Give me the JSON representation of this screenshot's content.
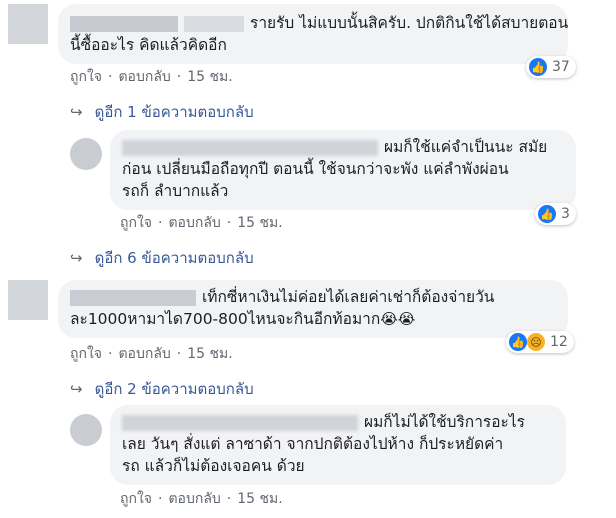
{
  "comments": [
    {
      "text": "รายรับ ไม่แบบนั้นสิครับ. ปกติกินใช้ได้สบายตอนนี้ซื้ออะไร คิดแล้วคิดอีก",
      "line1": "รายรับ ไม่แบบนั้นสิครับ. ปกติกินใช้ได้สบายตอน",
      "line2": "นี้ซื้ออะไร คิดแล้วคิดอีก",
      "like": "ถูกใจ",
      "reply": "ตอบกลับ",
      "time": "15 ชม.",
      "reaction_count": "37",
      "more_replies": "ดูอีก 1 ข้อความตอบกลับ"
    },
    {
      "line1": "ผมก็ใช้แค่จำเป็นนะ สมัย",
      "line2": "ก่อน เปลี่ยนมือถือทุกปี ตอนนี้ ใช้จนกว่าจะพัง แค่ลำพังผ่อน",
      "line3": "รถก็ ลำบากแล้ว",
      "like": "ถูกใจ",
      "reply": "ตอบกลับ",
      "time": "15 ชม.",
      "reaction_count": "3",
      "more_replies": "ดูอีก 6 ข้อความตอบกลับ"
    },
    {
      "line1": "เท็กซี่หาเงินไม่ค่อยได้เลยค่าเช่าก็ต้องจ่ายวัน",
      "line2": "ละ1000หามาได700-800ไหนจะกินอีกท้อมาก",
      "emoji": "😭😭",
      "like": "ถูกใจ",
      "reply": "ตอบกลับ",
      "time": "15 ชม.",
      "reaction_count": "12",
      "more_replies": "ดูอีก 2 ข้อความตอบกลับ"
    },
    {
      "line1": "ผมก็ไม่ได้ใช้บริการอะไร",
      "line2": "เลย วันๆ สั่งแต่ ลาซาด้า จากปกติต้องไปห้าง ก็ประหยัดค่า",
      "line3": "รถ แล้วก็ไม่ต้องเจอคน ด้วย",
      "like": "ถูกใจ",
      "reply": "ตอบกลับ",
      "time": "15 ชม."
    }
  ],
  "icons": {
    "like": "like-icon",
    "sad": "sad-icon",
    "reply_arrow": "reply-arrow-icon"
  },
  "colors": {
    "bubble": "#f2f3f5",
    "link": "#385898",
    "like_blue": "#1877f2",
    "meta": "#606770"
  }
}
